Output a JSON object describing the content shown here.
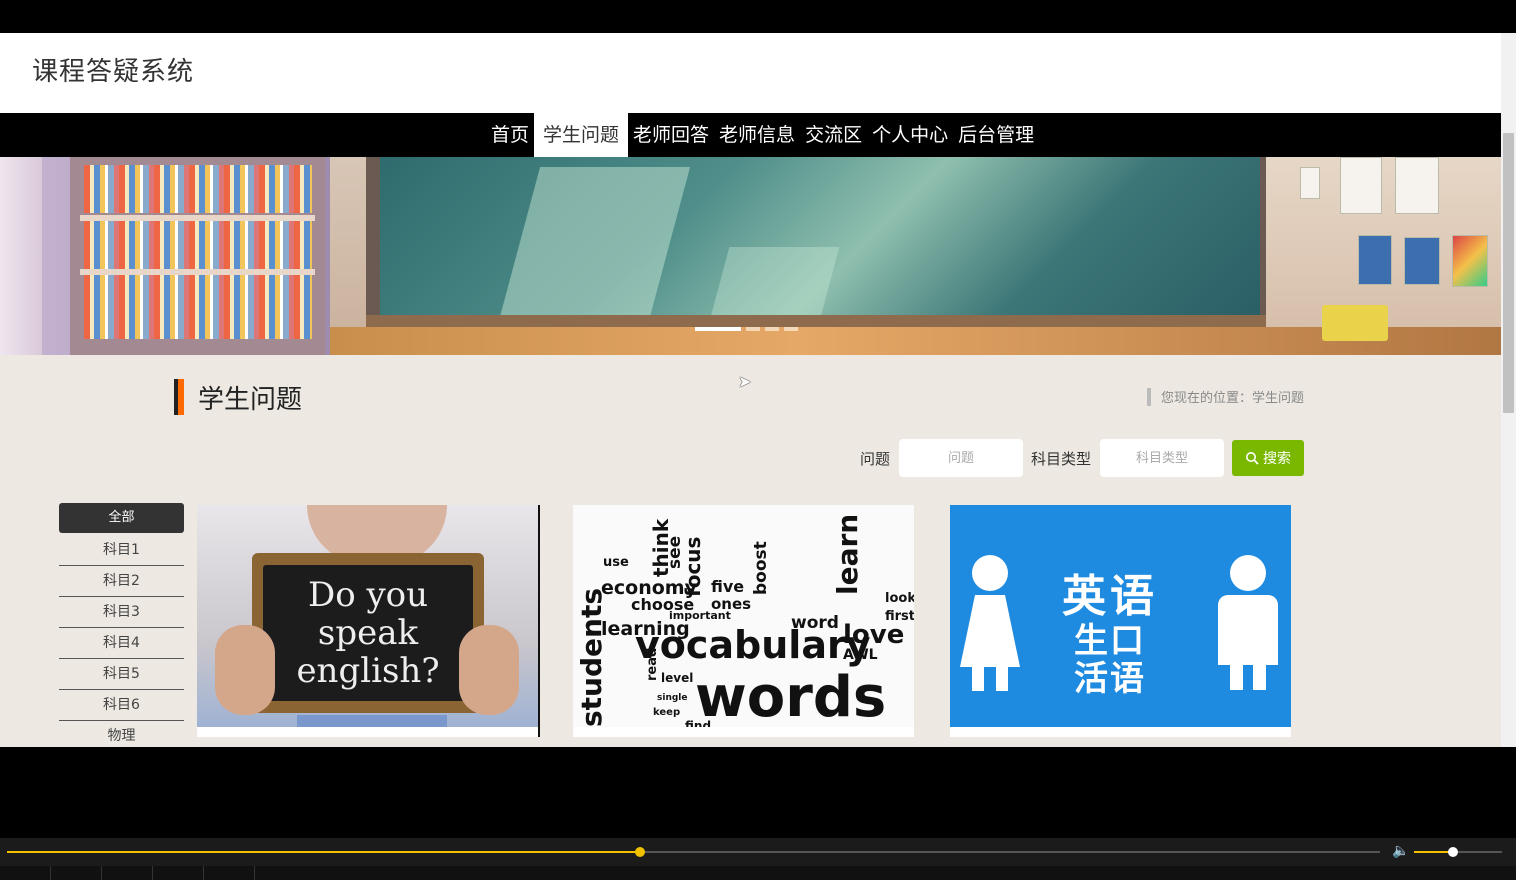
{
  "site": {
    "title": "课程答疑系统"
  },
  "nav": {
    "items": [
      {
        "label": "首页",
        "active": false
      },
      {
        "label": "学生问题",
        "active": true
      },
      {
        "label": "老师回答",
        "active": false
      },
      {
        "label": "老师信息",
        "active": false
      },
      {
        "label": "交流区",
        "active": false
      },
      {
        "label": "个人中心",
        "active": false
      },
      {
        "label": "后台管理",
        "active": false
      }
    ]
  },
  "banner": {
    "slide_count": 4,
    "active_slide": 1
  },
  "page": {
    "heading": "学生问题",
    "location": "您现在的位置：学生问题"
  },
  "search": {
    "question_label": "问题",
    "question_placeholder": "问题",
    "subject_label": "科目类型",
    "subject_placeholder": "科目类型",
    "button_label": "搜索"
  },
  "categories": [
    {
      "label": "全部",
      "active": true
    },
    {
      "label": "科目1",
      "active": false
    },
    {
      "label": "科目2",
      "active": false
    },
    {
      "label": "科目3",
      "active": false
    },
    {
      "label": "科目4",
      "active": false
    },
    {
      "label": "科目5",
      "active": false
    },
    {
      "label": "科目6",
      "active": false
    },
    {
      "label": "物理",
      "active": false
    }
  ],
  "cards": [
    {
      "image_text": [
        "Do you",
        "speak",
        "english?"
      ]
    },
    {
      "image_words": [
        "vocabulary",
        "words",
        "economy",
        "learning",
        "students",
        "choose",
        "love",
        "learn",
        "focus",
        "word",
        "five",
        "ones",
        "important",
        "boost",
        "think",
        "see",
        "use",
        "AWL",
        "look",
        "first",
        "level",
        "find",
        "keep",
        "single",
        "read"
      ]
    },
    {
      "image_text": [
        "英语",
        "生口",
        "活语"
      ]
    }
  ],
  "player": {
    "progress": 0.461,
    "volume": 0.44,
    "volume_icon": "speaker-icon",
    "accent_color": "#f2c100"
  }
}
